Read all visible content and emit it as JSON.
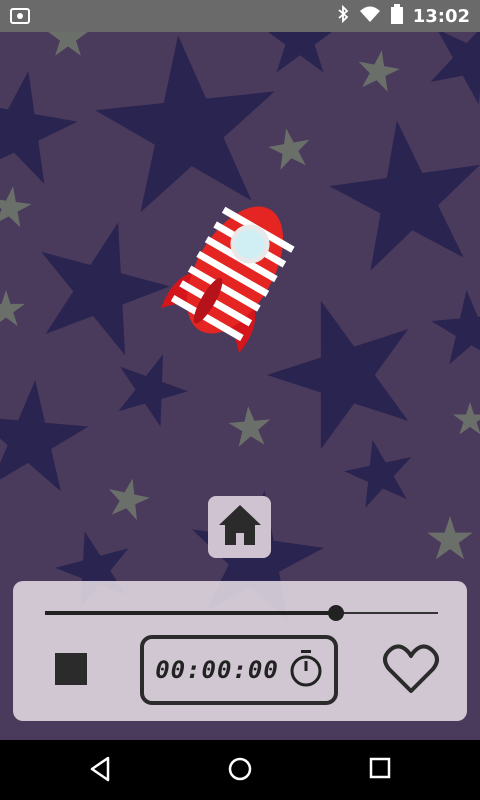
{
  "status_bar": {
    "time": "13:02",
    "icons": [
      "screenshot-icon",
      "bluetooth-icon",
      "wifi-icon",
      "battery-icon"
    ]
  },
  "background": {
    "base_color": "#4a3a5c",
    "star_color": "#2a2450",
    "small_star_color": "#6b6f6a"
  },
  "rocket": {
    "icon": "rocket-icon",
    "body_color": "#e52521",
    "stripe_color": "#ffffff",
    "window_color": "#cfeff5"
  },
  "home_button": {
    "icon": "home-icon"
  },
  "player": {
    "progress": 0.74,
    "timer_text": "00:00:00",
    "timer_icon": "stopwatch-icon",
    "stop_icon": "stop-icon",
    "favorite_icon": "heart-icon"
  },
  "nav_bar": {
    "icons": [
      "back-icon",
      "home-circle-icon",
      "recents-icon"
    ]
  }
}
